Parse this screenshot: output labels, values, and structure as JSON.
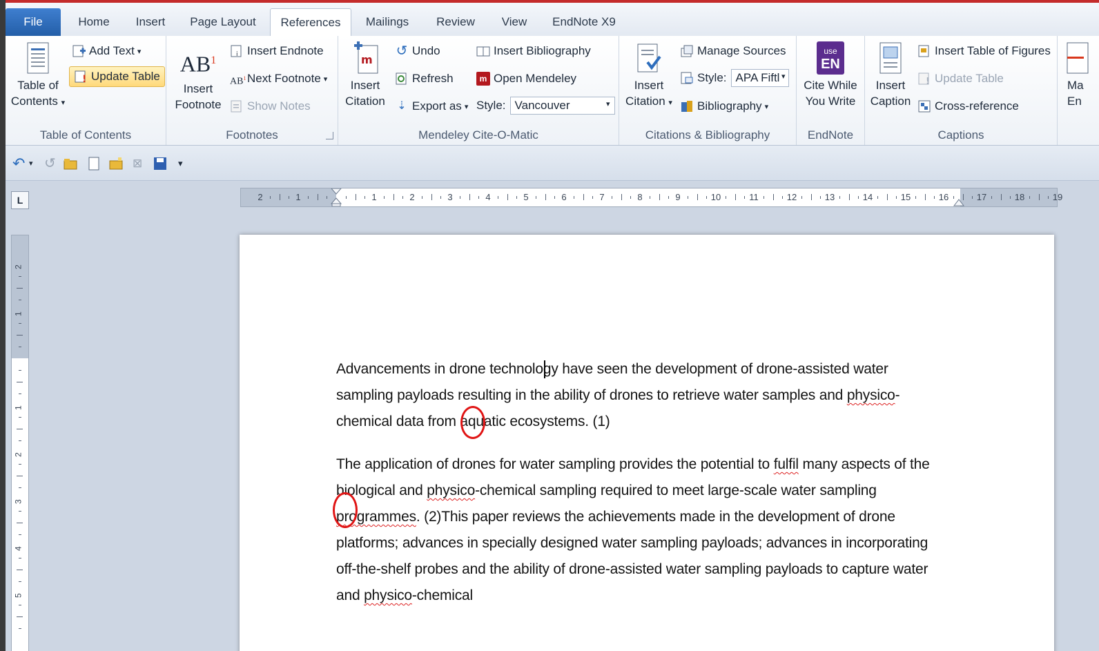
{
  "tabs": [
    "File",
    "Home",
    "Insert",
    "Page Layout",
    "References",
    "Mailings",
    "Review",
    "View",
    "EndNote X9"
  ],
  "active_tab": "References",
  "ribbon": {
    "toc": {
      "big_label_1": "Table of",
      "big_label_2": "Contents",
      "add_text": "Add Text",
      "update_table": "Update Table",
      "group": "Table of Contents"
    },
    "footnotes": {
      "insert_footnote_1": "Insert",
      "insert_footnote_2": "Footnote",
      "insert_endnote": "Insert Endnote",
      "next_footnote": "Next Footnote",
      "show_notes": "Show Notes",
      "group": "Footnotes"
    },
    "mendeley": {
      "insert_citation_1": "Insert",
      "insert_citation_2": "Citation",
      "undo": "Undo",
      "refresh": "Refresh",
      "export_as": "Export as",
      "style_label": "Style:",
      "style_value": "Vancouver",
      "insert_bibliography": "Insert Bibliography",
      "open_mendeley": "Open Mendeley",
      "group": "Mendeley Cite-O-Matic"
    },
    "citations": {
      "insert_citation_1": "Insert",
      "insert_citation_2": "Citation",
      "manage_sources": "Manage Sources",
      "style_label": "Style:",
      "style_value": "APA Fiftl",
      "bibliography": "Bibliography",
      "group": "Citations & Bibliography"
    },
    "endnote": {
      "icon_text_1": "use",
      "icon_text_2": "EN",
      "cite_while_1": "Cite While",
      "cite_while_2": "You Write",
      "group": "EndNote"
    },
    "captions": {
      "insert_caption_1": "Insert",
      "insert_caption_2": "Caption",
      "insert_table_of_figures": "Insert Table of Figures",
      "update_table": "Update Table",
      "cross_reference": "Cross-reference",
      "group": "Captions"
    },
    "overflow": {
      "label_1": "Ma",
      "label_2": "En"
    }
  },
  "ruler": {
    "corner": "L",
    "h_ticks": [
      "2",
      "1",
      "",
      "1",
      "2",
      "3",
      "4",
      "5",
      "6",
      "7",
      "8",
      "9",
      "10",
      "11",
      "12",
      "13",
      "14",
      "15",
      "16",
      "17",
      "18",
      "19"
    ],
    "v_ticks": [
      "2",
      "1",
      "",
      "1",
      "2",
      "3",
      "4",
      "5"
    ]
  },
  "document": {
    "p1": {
      "a": "Advancements in drone technology have seen the development of drone-assisted water sampling payloads resulting in the ability of drones to retrieve water samples and ",
      "w1": "physico",
      "b": "-chemical data from aquatic ecosystems. ",
      "cite": "(1)"
    },
    "p2": {
      "a": "The application of drones for water sampling provides the potential to ",
      "w1": "fulfil",
      "b": " many aspects of the biological and ",
      "w2": "physico",
      "c": "-chemical sampling required to meet large-scale water sampling ",
      "w3": "programmes",
      "d": ". ",
      "cite": "(2)",
      "e": "This paper reviews the achievements made in the development of drone platforms; advances in specially designed water sampling payloads; advances in incorporating off-the-shelf probes and the ability of drone-assisted water sampling payloads to capture water and ",
      "w4": "physico",
      "f": "-chemical"
    }
  },
  "colors": {
    "file_tab": "#2e6ebd",
    "accent_red": "#e01515",
    "ribbon_bg": "#f2f5f9"
  }
}
